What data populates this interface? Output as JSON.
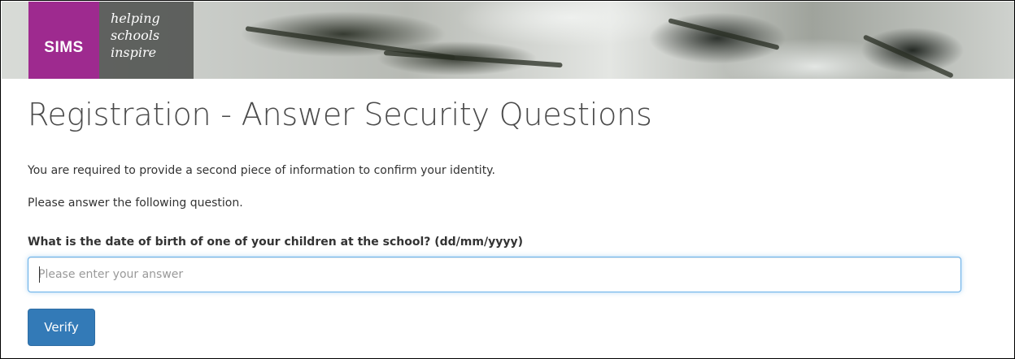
{
  "header": {
    "logo_text": "SIMS",
    "tagline": [
      "helping",
      "schools",
      "inspire"
    ]
  },
  "main": {
    "title": "Registration - Answer Security Questions",
    "intro": "You are required to provide a second piece of information to confirm your identity.",
    "instruction": "Please answer the following question.",
    "question": "What is the date of birth of one of your children at the school? (dd/mm/yyyy)",
    "answer": {
      "value": "",
      "placeholder": "Please enter your answer"
    },
    "verify_label": "Verify"
  },
  "colors": {
    "brand_purple": "#9e2a8f",
    "primary_button": "#337ab7",
    "input_focus": "#66afe9"
  }
}
